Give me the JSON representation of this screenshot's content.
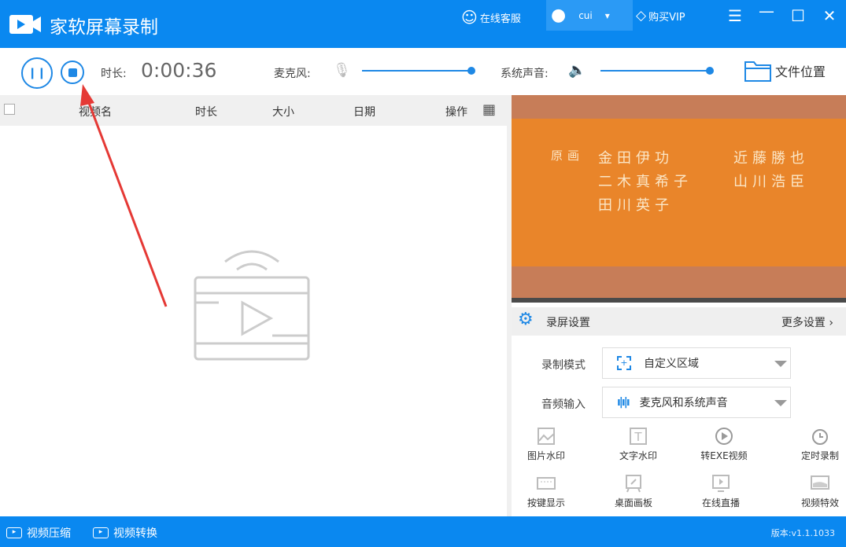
{
  "app": {
    "title": "家软屏幕录制"
  },
  "titlebar": {
    "support": "在线客服",
    "user": "cui",
    "vip": "购买VIP"
  },
  "toolbar": {
    "duration_label": "时长:",
    "duration": "0:00:36",
    "mic_label": "麦克风:",
    "sys_label": "系统声音:",
    "file_location": "文件位置",
    "mic_level": 100,
    "sys_level": 100
  },
  "table": {
    "columns": [
      "视频名",
      "时长",
      "大小",
      "日期",
      "操作"
    ]
  },
  "preview": {
    "credits": [
      "原画",
      "金田伊功",
      "近藤勝也",
      "二木真希子",
      "山川浩臣",
      "田川英子"
    ]
  },
  "settings": {
    "title": "录屏设置",
    "more": "更多设置",
    "mode_label": "录制模式",
    "mode_value": "自定义区域",
    "audio_label": "音频输入",
    "audio_value": "麦克风和系统声音"
  },
  "tools": [
    "图片水印",
    "文字水印",
    "转EXE视频",
    "定时录制",
    "按键显示",
    "桌面画板",
    "在线直播",
    "视频特效"
  ],
  "footer": {
    "compress": "视频压缩",
    "convert": "视频转换",
    "version": "版本:v1.1.1033"
  },
  "colors": {
    "brand": "#0a88f0",
    "accent": "#1e88e5"
  }
}
